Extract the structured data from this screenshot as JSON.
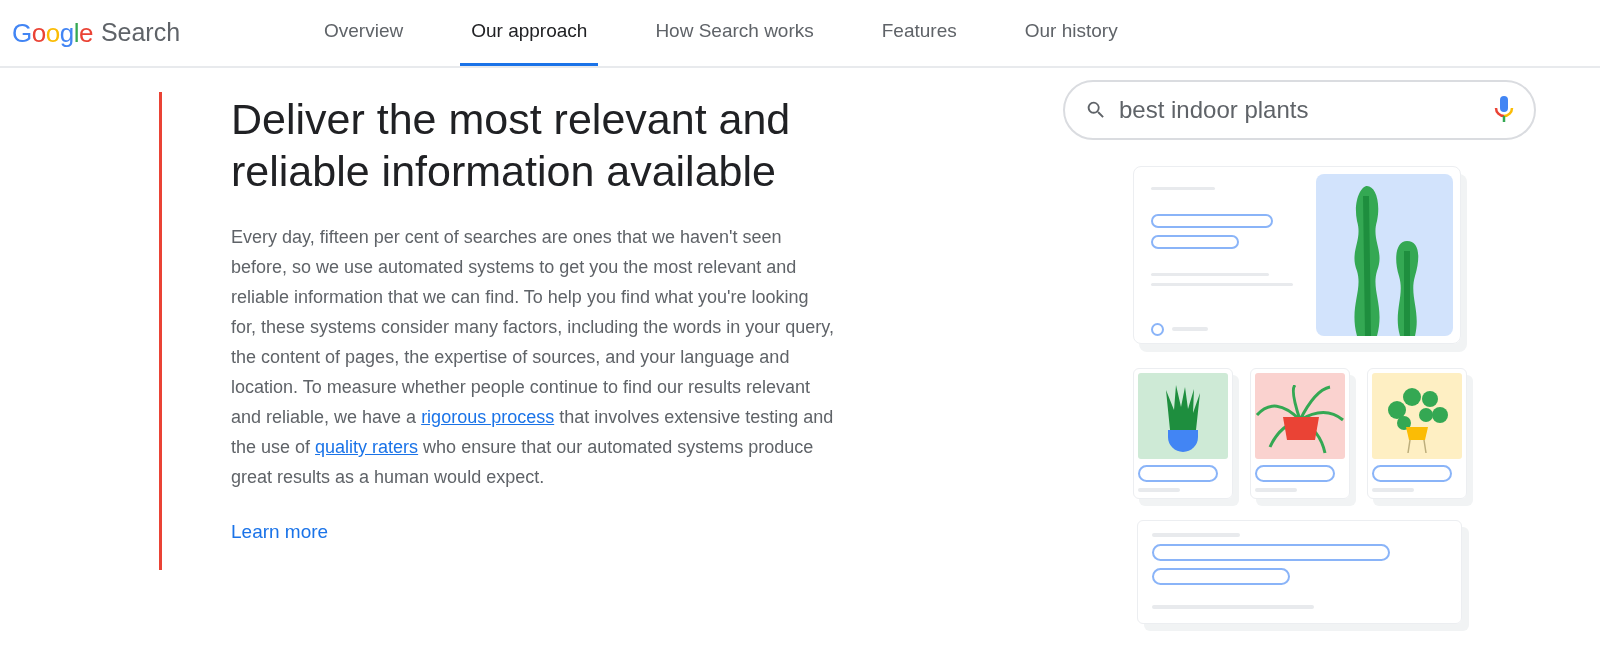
{
  "header": {
    "logo": "Google",
    "product": "Search"
  },
  "tabs": [
    {
      "label": "Overview",
      "selected": false
    },
    {
      "label": "Our approach",
      "selected": true
    },
    {
      "label": "How Search works",
      "selected": false
    },
    {
      "label": "Features",
      "selected": false
    },
    {
      "label": "Our history",
      "selected": false
    }
  ],
  "section": {
    "heading": "Deliver the most relevant and reliable information available",
    "body": [
      {
        "kind": "text",
        "text": "Every day, fifteen per cent of searches are ones that we haven't seen before, so we use automated systems to get you the most relevant and reliable information that we can find. To help you find what you're looking for, these systems consider many factors, including the words in your query, the content of pages, the expertise of sources, and your language and location. To measure whether people continue to find our results relevant and reliable, we have a "
      },
      {
        "kind": "link",
        "text": "rigorous process"
      },
      {
        "kind": "text",
        "text": " that involves extensive testing and the use of "
      },
      {
        "kind": "link",
        "text": "quality raters"
      },
      {
        "kind": "text",
        "text": " who ensure that our automated systems produce great results as a human would expect."
      }
    ],
    "link": "Learn more"
  },
  "illustration": {
    "query": "best indoor plants"
  }
}
